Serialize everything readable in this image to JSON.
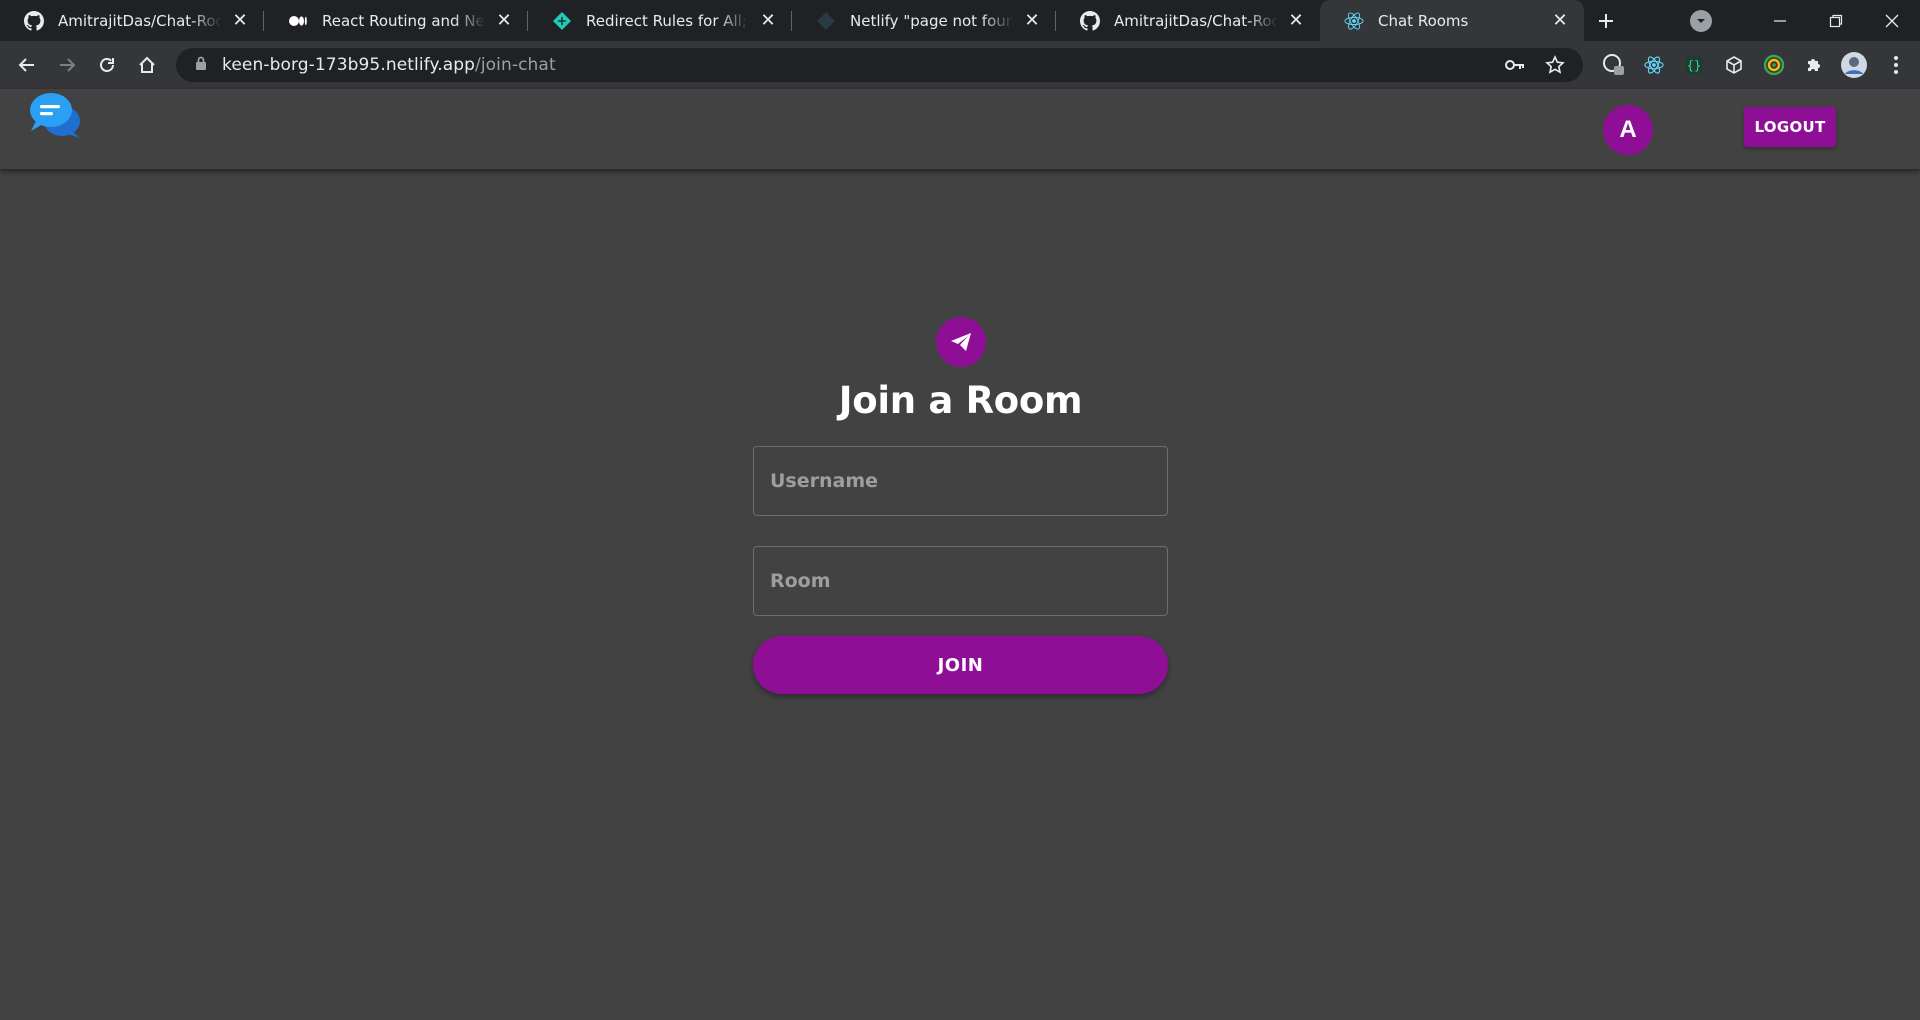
{
  "browser": {
    "tabs": [
      {
        "title": "AmitrajitDas/Chat-Rooms: A",
        "favicon": "github-icon"
      },
      {
        "title": "React Routing and Netlify Redirects",
        "favicon": "medium-icon"
      },
      {
        "title": "Redirect Rules for All; How to",
        "favicon": "netlify-icon"
      },
      {
        "title": "Netlify \"page not found\" when",
        "favicon": "netlify-dark-icon"
      },
      {
        "title": "AmitrajitDas/Chat-Rooms: A",
        "favicon": "github-icon"
      },
      {
        "title": "Chat Rooms",
        "favicon": "react-icon",
        "active": true
      }
    ],
    "url": {
      "host": "keen-borg-173b95.netlify.app",
      "path": "/join-chat"
    }
  },
  "header": {
    "logo": "chat-bubbles-icon",
    "avatar_initial": "A",
    "logout_label": "LOGOUT"
  },
  "join": {
    "icon": "paper-plane-icon",
    "title": "Join a Room",
    "username_placeholder": "Username",
    "username_value": "",
    "room_placeholder": "Room",
    "room_value": "",
    "join_label": "JOIN"
  },
  "colors": {
    "accent": "#8e0f96",
    "background": "#424242",
    "chrome_dark": "#202124",
    "chrome_toolbar": "#35363a"
  }
}
